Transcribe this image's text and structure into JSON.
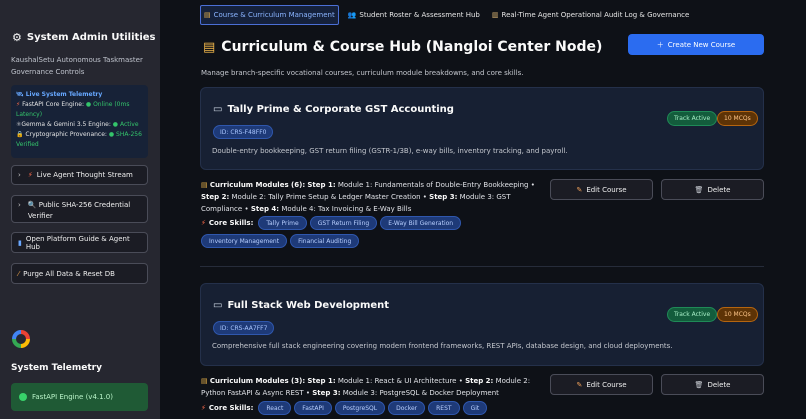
{
  "sidebar": {
    "title": "System Admin Utilities",
    "subtitle": "KaushalSetu Autonomous Taskmaster Governance Controls",
    "telemetry": {
      "head": "Live System Telemetry",
      "fastapi_label": "FastAPI Core Engine:",
      "fastapi_value": "Online (0ms Latency)",
      "gemma_label": "Gemma & Gemini 3.5 Engine:",
      "gemma_value": "Active",
      "crypto_label": "Cryptographic Provenance:",
      "crypto_value": "SHA-256 Verified"
    },
    "buttons": {
      "thought_stream": "Live Agent Thought Stream",
      "sha_verifier": "Public SHA-256 Credential Verifier",
      "platform_guide": "Open Platform Guide & Agent Hub",
      "purge": "Purge All Data & Reset DB"
    },
    "system_telemetry": "System Telemetry",
    "engine": "FastAPI Engine (v4.1.0)"
  },
  "tabs": [
    {
      "label": "Course & Curriculum Management"
    },
    {
      "label": "Student Roster & Assessment Hub"
    },
    {
      "label": "Real-Time Agent Operational Audit Log & Governance"
    }
  ],
  "main": {
    "title": "Curriculum & Course Hub (Nangloi Center Node)",
    "create_button": "Create New Course",
    "description": "Manage branch-specific vocational courses, curriculum module breakdowns, and core skills."
  },
  "courses": [
    {
      "title": "Tally Prime & Corporate GST Accounting",
      "id": "ID: CRS-F48FF0",
      "status": "Track Active",
      "mcqs": "10 MCQs",
      "description": "Double-entry bookkeeping, GST return filing (GSTR-1/3B), e-way bills, inventory tracking, and payroll.",
      "modules_label": "Curriculum Modules (6):",
      "modules": [
        {
          "step": "Step 1:",
          "text": "Module 1: Fundamentals of Double-Entry Bookkeeping"
        },
        {
          "step": "Step 2:",
          "text": "Module 2: Tally Prime Setup & Ledger Master Creation"
        },
        {
          "step": "Step 3:",
          "text": "Module 3: GST Compliance"
        },
        {
          "step": "Step 4:",
          "text": "Module 4: Tax Invoicing & E-Way Bills"
        }
      ],
      "skills_label": "Core Skills:",
      "skills": [
        "Tally Prime",
        "GST Return Filing",
        "E-Way Bill Generation",
        "Inventory Management",
        "Financial Auditing"
      ],
      "edit": "Edit Course",
      "delete": "Delete"
    },
    {
      "title": "Full Stack Web Development",
      "id": "ID: CRS-AA7FF7",
      "status": "Track Active",
      "mcqs": "10 MCQs",
      "description": "Comprehensive full stack engineering covering modern frontend frameworks, REST APIs, database design, and cloud deployments.",
      "modules_label": "Curriculum Modules (3):",
      "modules": [
        {
          "step": "Step 1:",
          "text": "Module 1: React & UI Architecture"
        },
        {
          "step": "Step 2:",
          "text": "Module 2: Python FastAPI & Async REST"
        },
        {
          "step": "Step 3:",
          "text": "Module 3: PostgreSQL & Docker Deployment"
        }
      ],
      "skills_label": "Core Skills:",
      "skills": [
        "React",
        "FastAPI",
        "PostgreSQL",
        "Docker",
        "REST",
        "Git"
      ],
      "edit": "Edit Course",
      "delete": "Delete"
    }
  ],
  "colors": {
    "background": "#0e1117",
    "sidebar": "#262730",
    "accent": "#2b6cf0",
    "success": "#34c46b",
    "warning": "#b5650f"
  },
  "icons": {
    "admin": "gear-icon",
    "telemetry": "satellite-icon",
    "stream": "lightning-icon",
    "verify": "magnifier-icon",
    "guide": "book-icon",
    "purge": "broom-icon",
    "edit": "pencil-icon",
    "delete": "trash-icon",
    "create": "plus-icon"
  }
}
